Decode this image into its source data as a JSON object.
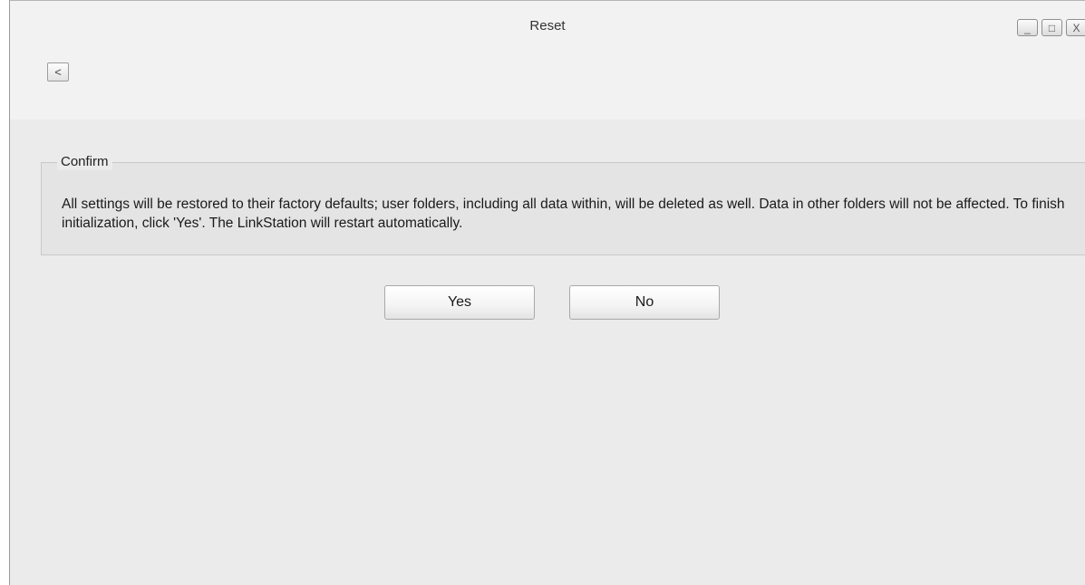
{
  "window": {
    "title": "Reset",
    "controls": {
      "minimize_glyph": "_",
      "maximize_glyph": "□",
      "close_glyph": "X"
    },
    "back_glyph": "<"
  },
  "confirm": {
    "legend": "Confirm",
    "message": "All settings will be restored to their factory defaults; user folders, including all data within, will be deleted as well. Data in other folders will not be affected. To finish initialization, click 'Yes'. The LinkStation will restart automatically."
  },
  "actions": {
    "yes_label": "Yes",
    "no_label": "No"
  },
  "icons": {
    "back": "chevron-left-icon",
    "minimize": "minimize-icon",
    "maximize": "maximize-icon",
    "close": "close-icon"
  }
}
